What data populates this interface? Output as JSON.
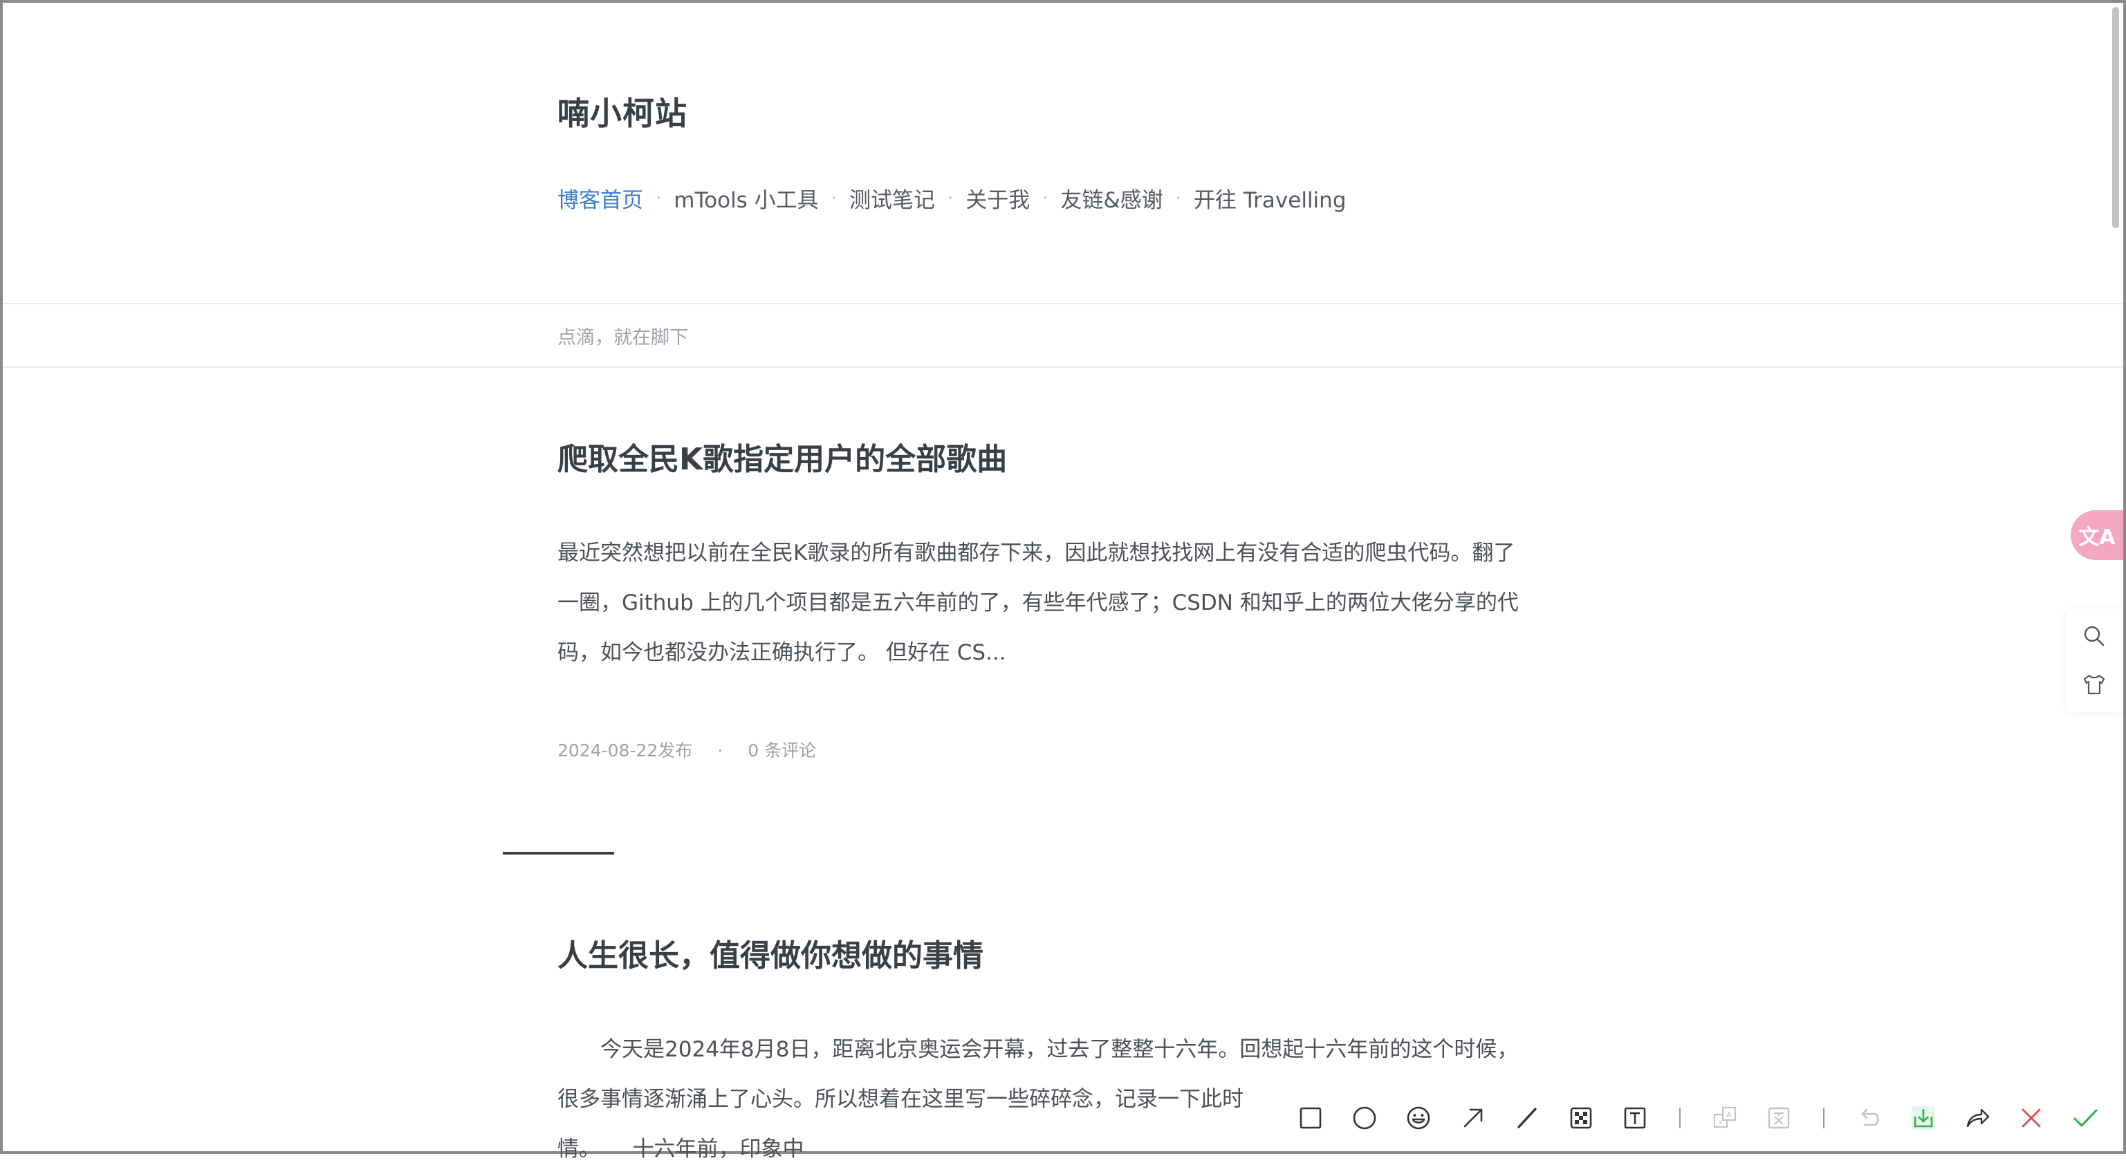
{
  "site": {
    "title": "喃小柯站",
    "tagline": "点滴，就在脚下"
  },
  "nav": {
    "items": [
      {
        "label": "博客首页",
        "active": true
      },
      {
        "label": "mTools 小工具",
        "active": false
      },
      {
        "label": "测试笔记",
        "active": false
      },
      {
        "label": "关于我",
        "active": false
      },
      {
        "label": "友链&感谢",
        "active": false
      },
      {
        "label": "开往 Travelling",
        "active": false
      }
    ],
    "separator": "·"
  },
  "posts": [
    {
      "title": "爬取全民K歌指定用户的全部歌曲",
      "excerpt_lines": [
        "最近突然想把以前在全民K歌录的所有歌曲都存下来，因此就想找找网上有没有合适的爬虫代码。翻了",
        "一圈，Github 上的几个项目都是五六年前的了，有些年代感了；CSDN 和知乎上的两位大佬分享的代",
        "码，如今也都没办法正确执行了。 但好在 CS..."
      ],
      "date": "2024-08-22发布",
      "meta_separator": "·",
      "comments": "0 条评论"
    },
    {
      "title": "人生很长，值得做你想做的事情",
      "excerpt_lines": [
        "　　今天是2024年8月8日，距离北京奥运会开幕，过去了整整十六年。回想起十六年前的这个时候，",
        "很多事情逐渐涌上了心头。所以想着在这里写一些碎碎念，记录一下此时",
        "情。　　十六年前，印象中"
      ]
    }
  ],
  "side_tools": {
    "translate_label": "文A",
    "icons": [
      "search-icon",
      "shirt-icon"
    ]
  },
  "snip_toolbar": {
    "tools": [
      "rectangle-icon",
      "ellipse-icon",
      "emoji-icon",
      "arrow-icon",
      "pen-icon",
      "mosaic-icon",
      "text-icon",
      "translate-image-icon",
      "ocr-icon",
      "undo-icon",
      "download-icon",
      "share-icon",
      "close-icon",
      "confirm-icon"
    ],
    "colors": {
      "download": "#2bb24c",
      "close": "#e5484d",
      "confirm": "#2bb24c",
      "disabled": "#c4c4c4",
      "icon": "#333333"
    }
  },
  "colors": {
    "accent": "#3d7bd4",
    "text": "#3a3f45",
    "muted": "#9ea3a8",
    "translate_bg": "#f4a7c3"
  }
}
